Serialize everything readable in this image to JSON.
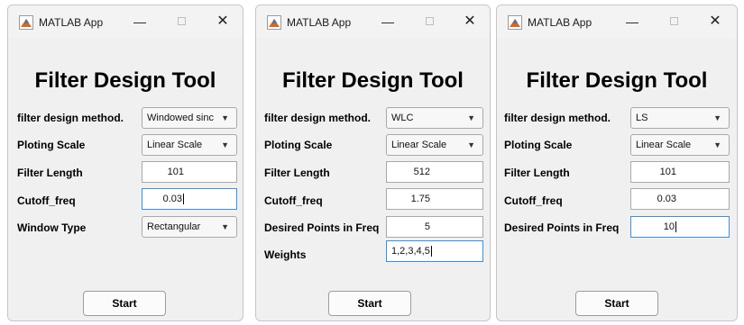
{
  "app_title": "MATLAB App",
  "heading": "Filter Design Tool",
  "start_label": "Start",
  "icons": {
    "app": "matlab-logo-icon",
    "minimize": "minimize-icon",
    "maximize": "maximize-icon",
    "close": "close-icon",
    "dropdown": "chevron-down-icon"
  },
  "window_controls": {
    "minimize": "—",
    "close": "✕"
  },
  "labels": {
    "method": "filter design method.",
    "scale": "Ploting Scale",
    "length": "Filter Length",
    "cutoff": "Cutoff_freq",
    "window_type": "Window Type",
    "desired_points": "Desired Points in Freq",
    "weights": "Weights"
  },
  "windows": [
    {
      "method": "Windowed sinc",
      "scale": "Linear Scale",
      "length": "101",
      "cutoff": "0.03",
      "window_type": "Rectangular"
    },
    {
      "method": "WLC",
      "scale": "Linear Scale",
      "length": "512",
      "cutoff": "1.75",
      "desired_points": "5",
      "weights": "1,2,3,4,5"
    },
    {
      "method": "LS",
      "scale": "Linear Scale",
      "length": "101",
      "cutoff": "0.03",
      "desired_points": "10"
    }
  ]
}
